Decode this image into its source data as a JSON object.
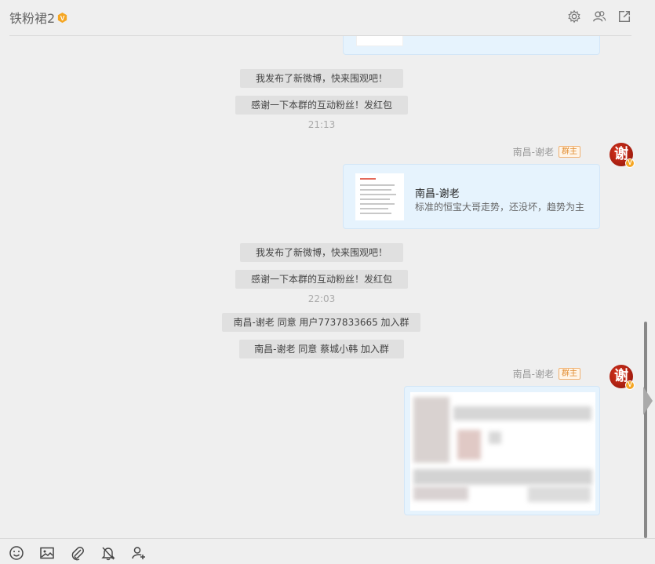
{
  "header": {
    "title": "铁粉裙2",
    "icons": [
      "settings-icon",
      "members-icon",
      "popout-icon"
    ]
  },
  "messages": {
    "sys1": "我发布了新微博，快来围观吧！",
    "sys2": "感谢一下本群的互动粉丝！发红包",
    "time1": "21:13",
    "sender_name": "南昌-谢老",
    "sender_role": "群主",
    "avatar_char": "谢",
    "share_title": "南昌-谢老",
    "share_desc": "标准的恒宝大哥走势，还没坏，趋势为主",
    "sys3": "我发布了新微博，快来围观吧！",
    "sys4": "感谢一下本群的互动粉丝！发红包",
    "time2": "22:03",
    "sys5": "南昌-谢老 同意 用户7737833665 加入群",
    "sys6": "南昌-谢老 同意 蔡城小韩 加入群",
    "sender2_name": "南昌-谢老",
    "sender2_role": "群主"
  },
  "toolbar": {
    "icons": [
      "emoji-icon",
      "image-icon",
      "attachment-icon",
      "mute-bell-icon",
      "add-member-icon"
    ]
  }
}
